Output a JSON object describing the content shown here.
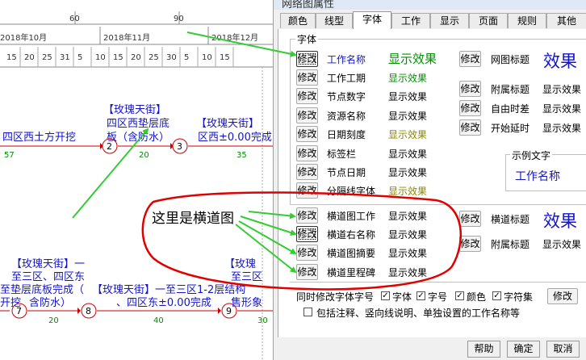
{
  "background": {
    "ruler_numbers": [
      "60",
      "90"
    ],
    "months": [
      "2018年10月",
      "2018年11月",
      "2018年12月"
    ],
    "days": [
      "15",
      "20",
      "25",
      "31",
      "5",
      "10",
      "15",
      "20",
      "25",
      "30",
      "5",
      "10",
      "15"
    ],
    "node_numbers": [
      "2",
      "3",
      "7",
      "8",
      "9"
    ],
    "durations": [
      "57",
      "20",
      "35",
      "20",
      "40",
      "30"
    ],
    "tasks": {
      "t1": "四区西土方开挖",
      "t2_line1": "【玫瑰天街】",
      "t2_line2": "四区西垫层底",
      "t2_line3": "板（含防水）",
      "t3_line1": "【玫瑰天街】",
      "t3_line2": "区西±0.00完成",
      "t4_line1": "【玫瑰天街】一",
      "t4_line2": "至三区、四区东",
      "t4_line3": "至垫层底板完成（",
      "t4_line4": "开挖",
      "t4_line5": "含防水）",
      "t5_line1": "【玫瑰天街】一至三区1-2层结构",
      "t5_line2": "、四区东±0.00完成",
      "t6_line1": "【玫瑰",
      "t6_line2": "至三区",
      "t6_line3": "售形象"
    }
  },
  "dialog": {
    "title": "网络图属性",
    "tabs": [
      "颜色",
      "线型",
      "字体",
      "工作",
      "显示",
      "页面",
      "规则",
      "其他"
    ],
    "active_tab": "字体",
    "font_group_label": "字体",
    "modify_label": "修改",
    "left_rows": [
      {
        "name": "工作名称",
        "sample": "显示效果"
      },
      {
        "name": "工作工期",
        "sample": "显示效果"
      },
      {
        "name": "节点数字",
        "sample": "显示效果"
      },
      {
        "name": "资源名称",
        "sample": "显示效果"
      },
      {
        "name": "日期刻度",
        "sample": "显示效果"
      },
      {
        "name": "标签栏",
        "sample": "显示效果"
      },
      {
        "name": "节点日期",
        "sample": "显示效果"
      },
      {
        "name": "分隔线字体",
        "sample": "显示效果"
      }
    ],
    "right_rows": [
      {
        "name": "网图标题",
        "sample": "效果"
      },
      {
        "name": "附属标题",
        "sample": "显示效果"
      },
      {
        "name": "自由时差",
        "sample": "显示效果"
      },
      {
        "name": "开始延时",
        "sample": "显示效果"
      }
    ],
    "example_group_label": "示例文字",
    "example_text": "工作名称",
    "bar_rows": [
      {
        "name": "横道图工作",
        "sample": "显示效果"
      },
      {
        "name": "横道右名称",
        "sample": "显示效果"
      },
      {
        "name": "横道图摘要",
        "sample": "显示效果"
      },
      {
        "name": "横道里程碑",
        "sample": "显示效果"
      }
    ],
    "bar_right_rows": [
      {
        "name": "横道标题",
        "sample": "效果"
      },
      {
        "name": "附属标题",
        "sample": "显示效果"
      }
    ],
    "sync_label": "同时修改字体字号",
    "sync_options": [
      "字体",
      "字号",
      "颜色",
      "字符集"
    ],
    "sync_modify": "修改",
    "include_note": "包括注释、竖向线说明、单独设置的工作名称等",
    "help_button": "帮助",
    "ok_button": "确定",
    "cancel_button": "取消",
    "colors": {
      "blue": "#1515c8",
      "green": "#009000",
      "olive": "#8a8a00"
    }
  },
  "annotation": {
    "text": "这里是横道图",
    "arrow_color": "#33cc33",
    "circle_color": "#e00000"
  }
}
